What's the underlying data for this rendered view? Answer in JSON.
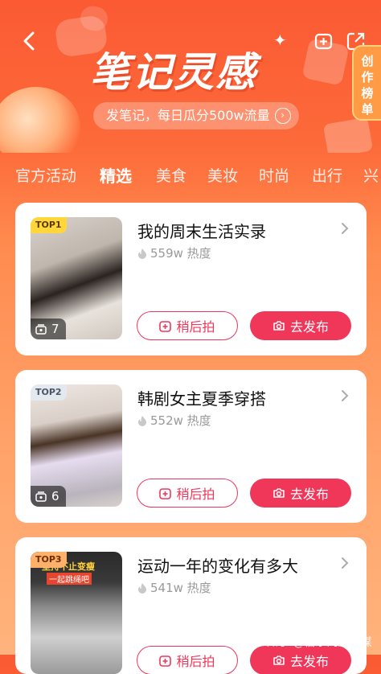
{
  "header": {
    "title": "笔记灵感",
    "subtitle": "发笔记，每日瓜分500w流量",
    "side_tab": [
      "创",
      "作",
      "榜",
      "单"
    ]
  },
  "tabs": [
    {
      "label": "官方活动",
      "active": false
    },
    {
      "label": "精选",
      "active": true
    },
    {
      "label": "美食",
      "active": false
    },
    {
      "label": "美妆",
      "active": false
    },
    {
      "label": "时尚",
      "active": false
    },
    {
      "label": "出行",
      "active": false
    },
    {
      "label": "兴",
      "active": false
    }
  ],
  "cards": [
    {
      "rank": "TOP1",
      "title": "我的周末生活实录",
      "heat": "559w 热度",
      "count": "7",
      "later_label": "稍后拍",
      "post_label": "去发布"
    },
    {
      "rank": "TOP2",
      "title": "韩剧女主夏季穿搭",
      "heat": "552w 热度",
      "count": "6",
      "later_label": "稍后拍",
      "post_label": "去发布"
    },
    {
      "rank": "TOP3",
      "title": "运动一年的变化有多大",
      "heat": "541w 热度",
      "count": "",
      "later_label": "稍后拍",
      "post_label": "去发布"
    }
  ],
  "thumb_overlay_text": {
    "top3_caption_1": "坚持不止变瘦",
    "top3_caption_2": "一起跳绳吧"
  },
  "watermark": "知乎 @伯乐网络传媒",
  "colors": {
    "accent": "#f0375a",
    "header_bg": "#fb5a33",
    "badge_top1": "#ffd73b",
    "badge_top2": "#e4e8ef",
    "badge_top3": "#ffb06a"
  },
  "icons": {
    "back": "chevron-left-icon",
    "add": "add-box-icon",
    "share": "share-icon",
    "heat": "flame-icon",
    "later": "add-box-icon",
    "post": "camera-icon",
    "count": "photo-stack-icon"
  }
}
